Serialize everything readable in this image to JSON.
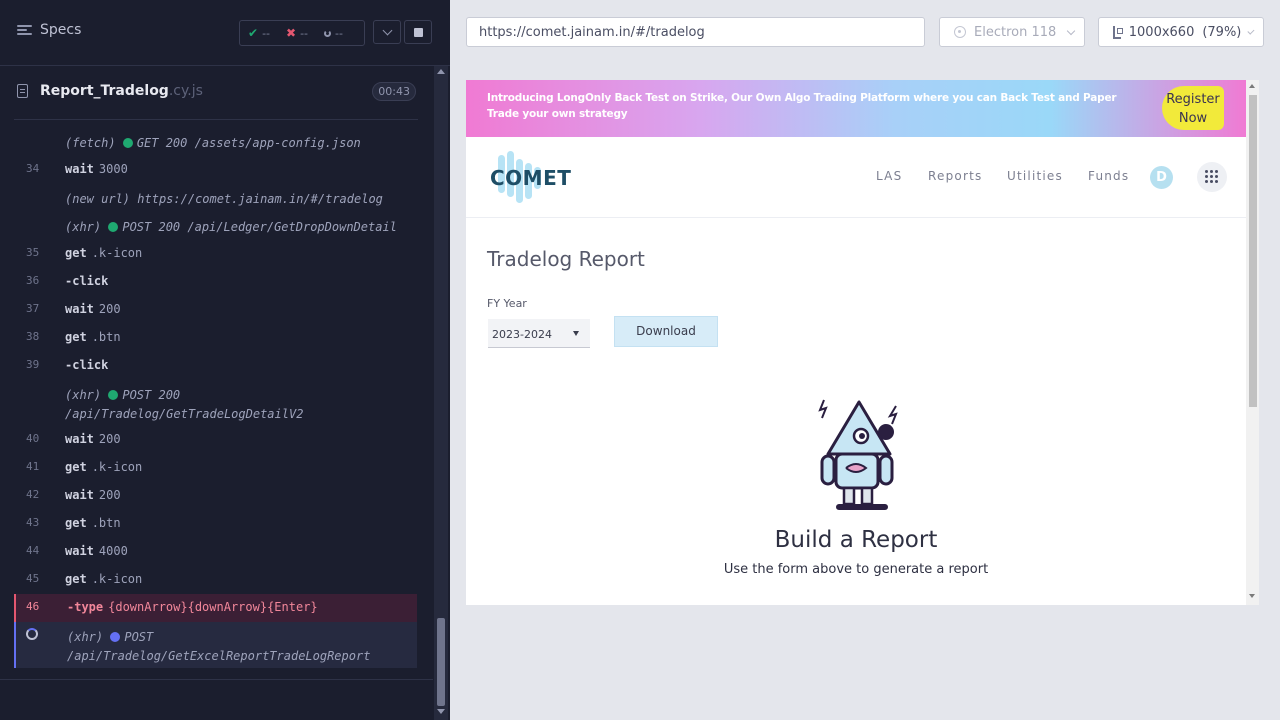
{
  "runner": {
    "title": "Specs",
    "stats": {
      "passed": "--",
      "failed": "--",
      "pending": "--"
    },
    "file": {
      "name": "Report_Tradelog",
      "ext": ".cy.js",
      "duration": "00:43"
    },
    "commands": [
      {
        "num": "",
        "kind": "event",
        "prefix": "(fetch)",
        "dot": "green",
        "text": "GET 200 /assets/app-config.json"
      },
      {
        "num": "34",
        "kind": "cmd",
        "name": "wait",
        "arg": "3000"
      },
      {
        "num": "",
        "kind": "event",
        "prefix": "(new url)",
        "dot": "",
        "text": "https://comet.jainam.in/#/tradelog"
      },
      {
        "num": "",
        "kind": "event",
        "prefix": "(xhr)",
        "dot": "green",
        "text": "POST 200 /api/Ledger/GetDropDownDetail"
      },
      {
        "num": "35",
        "kind": "cmd",
        "name": "get",
        "arg": ".k-icon"
      },
      {
        "num": "36",
        "kind": "cmd",
        "name": "-click",
        "arg": ""
      },
      {
        "num": "37",
        "kind": "cmd",
        "name": "wait",
        "arg": "200"
      },
      {
        "num": "38",
        "kind": "cmd",
        "name": "get",
        "arg": ".btn"
      },
      {
        "num": "39",
        "kind": "cmd",
        "name": "-click",
        "arg": ""
      },
      {
        "num": "",
        "kind": "event2",
        "prefix": "(xhr)",
        "dot": "green",
        "text": "POST 200",
        "text2": "/api/Tradelog/GetTradeLogDetailV2"
      },
      {
        "num": "40",
        "kind": "cmd",
        "name": "wait",
        "arg": "200"
      },
      {
        "num": "41",
        "kind": "cmd",
        "name": "get",
        "arg": ".k-icon"
      },
      {
        "num": "42",
        "kind": "cmd",
        "name": "wait",
        "arg": "200"
      },
      {
        "num": "43",
        "kind": "cmd",
        "name": "get",
        "arg": ".btn"
      },
      {
        "num": "44",
        "kind": "cmd",
        "name": "wait",
        "arg": "4000"
      },
      {
        "num": "45",
        "kind": "cmd",
        "name": "get",
        "arg": ".k-icon"
      },
      {
        "num": "46",
        "kind": "err",
        "name": "-type",
        "arg": "{downArrow}{downArrow}{Enter}"
      },
      {
        "num": "",
        "kind": "running",
        "prefix": "(xhr)",
        "dot": "blue",
        "text": "POST",
        "text2": "/api/Tradelog/GetExcelReportTradeLogReport"
      }
    ]
  },
  "browser_bar": {
    "url": "https://comet.jainam.in/#/tradelog",
    "browser": "Electron 118",
    "viewport": "1000x660",
    "zoom": "(79%)"
  },
  "app": {
    "banner": {
      "text": "Introducing LongOnly Back Test on Strike, Our Own Algo Trading Platform where you can Back Test and Paper Trade your own strategy",
      "cta_line1": "Register",
      "cta_line2": "Now"
    },
    "logo": "COMET",
    "nav": [
      "LAS",
      "Reports",
      "Utilities",
      "Funds"
    ],
    "avatar": "D",
    "title": "Tradelog Report",
    "fy_label": "FY Year",
    "fy_value": "2023-2024",
    "download_label": "Download",
    "empty_title": "Build a Report",
    "empty_subtitle": "Use the form above to generate a report"
  }
}
